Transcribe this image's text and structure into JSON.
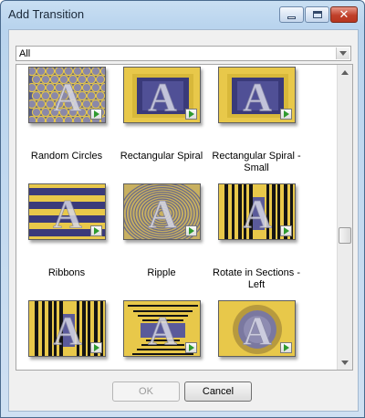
{
  "window": {
    "title": "Add Transition",
    "close_glyph": "✕"
  },
  "filter": {
    "selected": "All"
  },
  "transitions": [
    {
      "name": "Random Circles",
      "pattern": "circles"
    },
    {
      "name": "Rectangular Spiral",
      "pattern": "spiral"
    },
    {
      "name": "Rectangular Spiral - Small",
      "pattern": "spiral"
    },
    {
      "name": "Ribbons",
      "pattern": "ribbons"
    },
    {
      "name": "Ripple",
      "pattern": "ripple"
    },
    {
      "name": "Rotate in Sections - Left",
      "pattern": "sections"
    },
    {
      "name": "",
      "pattern": "sections"
    },
    {
      "name": "",
      "pattern": "stripes"
    },
    {
      "name": "",
      "pattern": "rings"
    }
  ],
  "thumbnail_letter": "A",
  "buttons": {
    "ok": "OK",
    "cancel": "Cancel"
  },
  "colors": {
    "gold": "#e8c84a",
    "navy": "#3a3a7a",
    "play_green": "#2e9a2e"
  },
  "icons": {
    "play": "play-icon",
    "dropdown": "chevron-down-icon"
  }
}
